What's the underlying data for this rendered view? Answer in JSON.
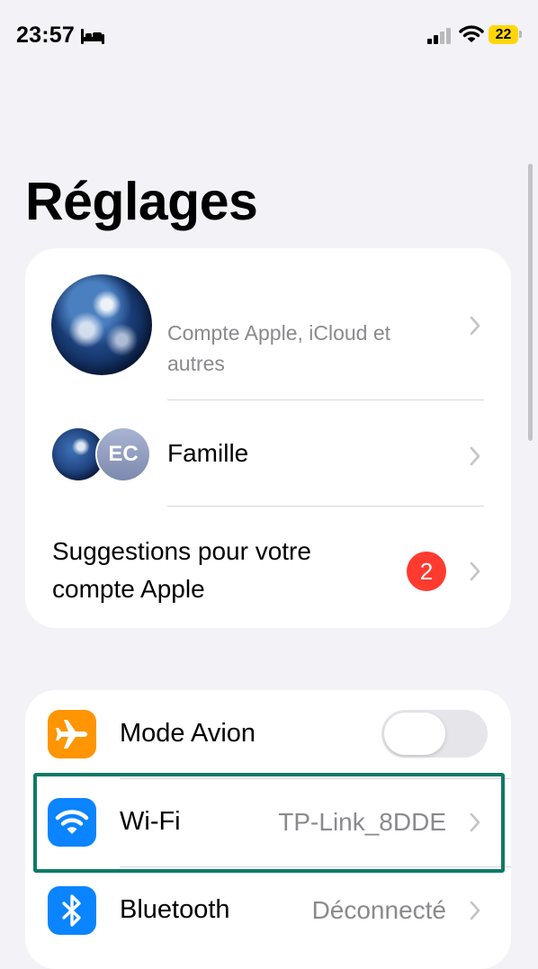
{
  "status_bar": {
    "time": "23:57",
    "focus_icon": "bed-icon",
    "signal_icon": "cellular-signal-icon",
    "wifi_icon": "wifi-icon",
    "battery_level": "22",
    "battery_color": "#ffd60a"
  },
  "page": {
    "title": "Réglages"
  },
  "account": {
    "subtitle": "Compte Apple, iCloud et autres",
    "avatar": "earth-avatar"
  },
  "family": {
    "label": "Famille",
    "initials": "EC"
  },
  "suggestions": {
    "label": "Suggestions pour votre compte Apple",
    "badge_count": "2",
    "badge_color": "#ff3b30"
  },
  "network": {
    "airplane": {
      "label": "Mode Avion",
      "icon": "airplane-icon",
      "toggle_on": false
    },
    "wifi": {
      "label": "Wi-Fi",
      "value": "TP-Link_8DDE",
      "icon": "wifi-icon"
    },
    "bluetooth": {
      "label": "Bluetooth",
      "value": "Déconnecté",
      "icon": "bluetooth-icon"
    }
  },
  "highlight": {
    "target": "wifi-row",
    "color": "#0f7a65"
  }
}
